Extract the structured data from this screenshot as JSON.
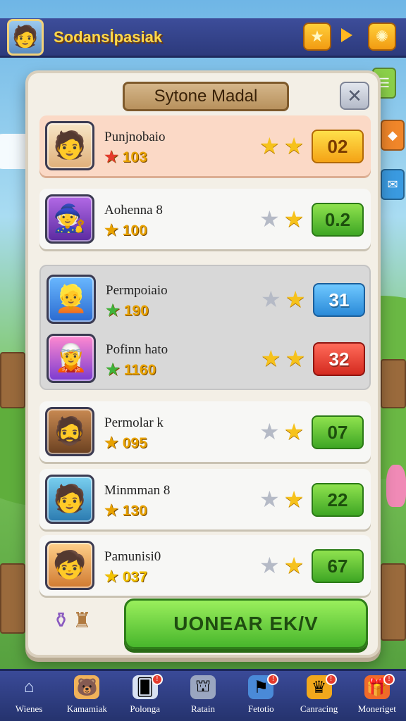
{
  "topbar": {
    "title": "Sodansİpasiak",
    "avatar_icon": "hero-avatar-icon",
    "star_button_icon": "star-icon",
    "play_icon": "play-arrow-icon",
    "coin_button_icon": "gear-coin-icon"
  },
  "modal": {
    "title": "Sytone Madal",
    "close_label": "✕",
    "players": [
      {
        "name": "Punjnobaio",
        "score": "103",
        "rating_stars": 2,
        "badge": "02",
        "badge_color": "orange",
        "highlight": true
      },
      {
        "name": "Aohenna 8",
        "score": "100",
        "rating_stars": 1,
        "badge": "0.2",
        "badge_color": "green",
        "highlight": false
      },
      {
        "name": "Permpoiaio",
        "score": "190",
        "rating_stars": 1,
        "badge": "31",
        "badge_color": "blue",
        "highlight": false
      },
      {
        "name": "Pofinn hato",
        "score": "1160",
        "rating_stars": 2,
        "badge": "32",
        "badge_color": "red",
        "highlight": false
      },
      {
        "name": "Permolar k",
        "score": "095",
        "rating_stars": 1,
        "badge": "07",
        "badge_color": "green",
        "highlight": false
      },
      {
        "name": "Minmman 8",
        "score": "130",
        "rating_stars": 1,
        "badge": "22",
        "badge_color": "green",
        "highlight": false
      },
      {
        "name": "Pamunisi0",
        "score": "037",
        "rating_stars": 1,
        "badge": "67",
        "badge_color": "green",
        "highlight": false
      }
    ],
    "cta_label": "UONEAR EK/V"
  },
  "bottom_nav": [
    {
      "label": "Wienes",
      "icon": "home-icon",
      "badge": ""
    },
    {
      "label": "Kamamiak",
      "icon": "character-icon",
      "badge": ""
    },
    {
      "label": "Polonga",
      "icon": "cards-icon",
      "badge": "!"
    },
    {
      "label": "Ratain",
      "icon": "shop-icon",
      "badge": ""
    },
    {
      "label": "Fetotio",
      "icon": "map-icon",
      "badge": "!"
    },
    {
      "label": "Canracing",
      "icon": "trophy-icon",
      "badge": "!"
    },
    {
      "label": "Moneriget",
      "icon": "gift-icon",
      "badge": "!"
    }
  ],
  "colors": {
    "topbar": "#3d4d9a",
    "gold": "#f6c21c",
    "cta_green": "#48b62c",
    "modal_bg": "#f3efe6"
  }
}
